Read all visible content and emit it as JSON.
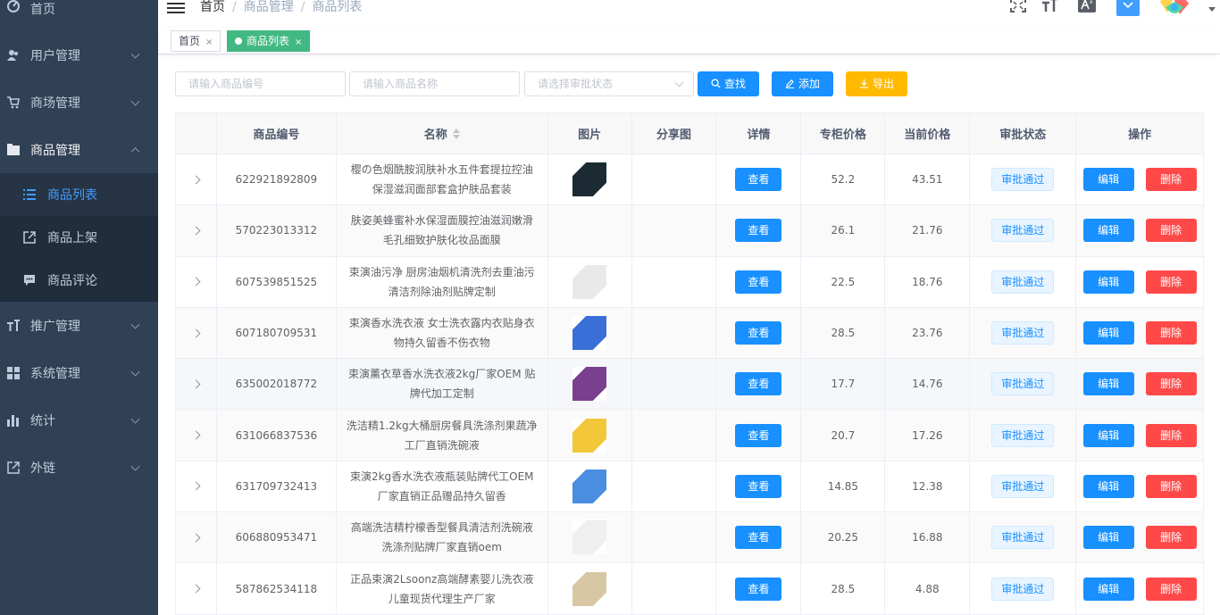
{
  "sidebar": {
    "home": "首页",
    "user_mgmt": "用户管理",
    "mall_mgmt": "商场管理",
    "goods_mgmt": "商品管理",
    "goods_list": "商品列表",
    "goods_publish": "商品上架",
    "goods_comment": "商品评论",
    "promo_mgmt": "推广管理",
    "system_mgmt": "系统管理",
    "stats": "统计",
    "external": "外链"
  },
  "breadcrumb": [
    "首页",
    "商品管理",
    "商品列表"
  ],
  "tags": {
    "home": "首页",
    "goods_list": "商品列表",
    "close": "×"
  },
  "filter": {
    "code_placeholder": "请输入商品编号",
    "name_placeholder": "请输入商品名称",
    "status_placeholder": "请选择审批状态",
    "search": "查找",
    "add": "添加",
    "export": "导出"
  },
  "table": {
    "headers": [
      "商品编号",
      "名称",
      "图片",
      "分享图",
      "详情",
      "专柜价格",
      "当前价格",
      "审批状态",
      "操作"
    ],
    "view_label": "查看",
    "edit_label": "编辑",
    "delete_label": "删除",
    "rows": [
      {
        "code": "622921892809",
        "name": "樱の色烟酰胺润肤补水五件套提拉控油保湿滋润面部套盒护肤品套装",
        "has_image": true,
        "img_color": "#1c2a33",
        "counter_price": "52.2",
        "price": "43.51",
        "status": "审批通过"
      },
      {
        "code": "570223013312",
        "name": "肤姿美蜂蜜补水保湿面膜控油滋润嫩滑毛孔细致护肤化妆品面膜",
        "has_image": false,
        "img_color": "",
        "counter_price": "26.1",
        "price": "21.76",
        "status": "审批通过"
      },
      {
        "code": "607539851525",
        "name": "束演油污净 厨房油烟机清洗剂去重油污清洁剂除油剂贴牌定制",
        "has_image": true,
        "img_color": "#e9e9e9",
        "counter_price": "22.5",
        "price": "18.76",
        "status": "审批通过"
      },
      {
        "code": "607180709531",
        "name": "束演香水洗衣液 女士洗衣露内衣贴身衣物持久留香不伤衣物",
        "has_image": true,
        "img_color": "#3a6fd8",
        "counter_price": "28.5",
        "price": "23.76",
        "status": "审批通过"
      },
      {
        "code": "635002018772",
        "name": "束演薰衣草香水洗衣液2kg厂家OEM 贴牌代加工定制",
        "has_image": true,
        "img_color": "#7b3f8f",
        "counter_price": "17.7",
        "price": "14.76",
        "status": "审批通过"
      },
      {
        "code": "631066837536",
        "name": "洗洁精1.2kg大桶厨房餐具洗涤剂果蔬净工厂直销洗碗液",
        "has_image": true,
        "img_color": "#f2c73a",
        "counter_price": "20.7",
        "price": "17.26",
        "status": "审批通过"
      },
      {
        "code": "631709732413",
        "name": "束演2kg香水洗衣液瓶装贴牌代工OEM厂家直销正品赠品持久留香",
        "has_image": true,
        "img_color": "#4a8ee0",
        "counter_price": "14.85",
        "price": "12.38",
        "status": "审批通过"
      },
      {
        "code": "606880953471",
        "name": "高端洗洁精柠檬香型餐具清洁剂洗碗液洗涤剂贴牌厂家直销oem",
        "has_image": true,
        "img_color": "#efefef",
        "counter_price": "20.25",
        "price": "16.88",
        "status": "审批通过"
      },
      {
        "code": "587862534118",
        "name": "正品束演2Lsoonz高端酵素婴儿洗衣液儿童现货代理生产厂家",
        "has_image": true,
        "img_color": "#d8c7a3",
        "counter_price": "28.5",
        "price": "4.88",
        "status": "审批通过"
      }
    ]
  },
  "colors": {
    "sidebar_bg": "#304156",
    "accent": "#1890ff",
    "tag_active": "#42b983",
    "danger": "#ff4949",
    "warning": "#ffba00"
  }
}
